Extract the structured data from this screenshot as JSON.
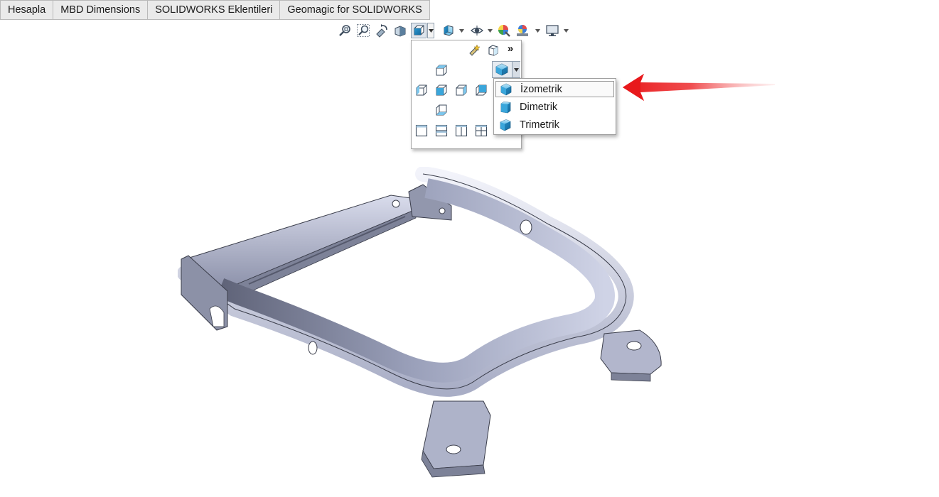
{
  "tabs": [
    "Hesapla",
    "MBD Dimensions",
    "SOLIDWORKS Eklentileri",
    "Geomagic for SOLIDWORKS"
  ],
  "toolbar": {
    "icons": [
      "zoom-to-fit-icon",
      "zoom-to-area-icon",
      "previous-view-icon",
      "section-view-icon",
      "view-orientation-icon",
      "display-style-icon",
      "hide-show-items-icon",
      "edit-appearance-icon",
      "apply-scene-icon",
      "view-settings-icon"
    ]
  },
  "orientation_flyout": {
    "more_label": "»",
    "icons": [
      "view-selector-icon",
      "normal-to-icon",
      "top-view-icon",
      "left-view-icon",
      "front-view-icon",
      "right-view-icon",
      "back-view-icon",
      "bottom-view-icon",
      "single-view-icon",
      "two-view-horizontal-icon",
      "two-view-vertical-icon",
      "four-view-icon",
      "isometric-icon"
    ]
  },
  "iso_menu": {
    "items": [
      "İzometrik",
      "Dimetrik",
      "Trimetrik"
    ],
    "highlighted": "İzometrik"
  },
  "colors": {
    "accent_blue": "#2f9fd6",
    "arrow_red": "#e8191c",
    "model_steel": "#a9aec6"
  }
}
